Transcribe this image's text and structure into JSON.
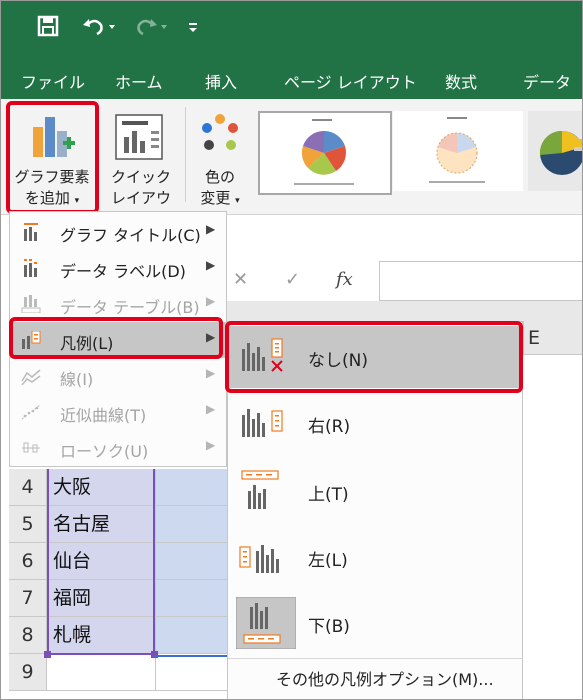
{
  "quick_access": {
    "save_icon": "save-icon",
    "undo_icon": "undo-icon",
    "redo_icon": "redo-icon",
    "customize_icon": "customize-icon"
  },
  "tabs": [
    "ファイル",
    "ホーム",
    "挿入",
    "ページ レイアウト",
    "数式",
    "データ"
  ],
  "ribbon": {
    "add_chart_element_line1": "グラフ要素",
    "add_chart_element_line2": "を追加",
    "quick_layout_line1": "クイック",
    "quick_layout_line2": "レイアウト",
    "change_colors_line1": "色の",
    "change_colors_line2": "変更"
  },
  "formula_bar": {
    "cancel": "✕",
    "enter": "✓",
    "fx": "fx"
  },
  "column_header_e": "E",
  "rows": [
    {
      "num": "4",
      "city": "大阪"
    },
    {
      "num": "5",
      "city": "名古屋"
    },
    {
      "num": "6",
      "city": "仙台"
    },
    {
      "num": "7",
      "city": "福岡"
    },
    {
      "num": "8",
      "city": "札幌"
    },
    {
      "num": "9",
      "city": ""
    }
  ],
  "menu": [
    {
      "label": "グラフ タイトル(C)",
      "disabled": false
    },
    {
      "label": "データ ラベル(D)",
      "disabled": false
    },
    {
      "label": "データ テーブル(B)",
      "disabled": true
    },
    {
      "label": "凡例(L)",
      "disabled": false
    },
    {
      "label": "線(I)",
      "disabled": true
    },
    {
      "label": "近似曲線(T)",
      "disabled": true
    },
    {
      "label": "ローソク(U)",
      "disabled": true
    }
  ],
  "submenu": [
    {
      "label": "なし(N)"
    },
    {
      "label": "右(R)"
    },
    {
      "label": "上(T)"
    },
    {
      "label": "左(L)"
    },
    {
      "label": "下(B)"
    }
  ],
  "submenu_more": "その他の凡例オプション(M)...",
  "colors": {
    "excel_green": "#217346",
    "highlight_red": "#e0001b",
    "menu_hover": "#c6c6c6"
  }
}
